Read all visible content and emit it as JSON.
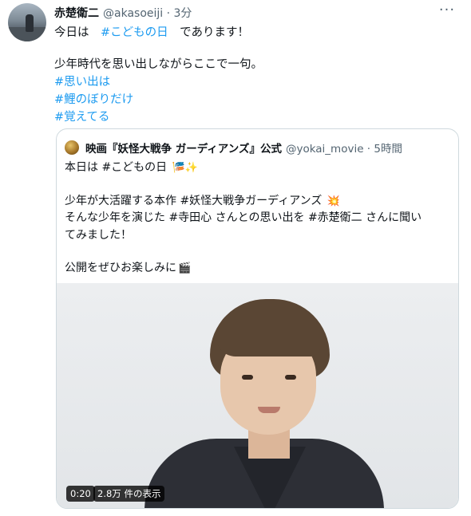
{
  "tweet": {
    "author_name": "赤楚衛二",
    "author_handle": "@akasoeiji · 3分",
    "more_icon": "more-horizontal-icon",
    "lines": [
      {
        "plain": "今日は　",
        "tag": "#こどもの日",
        "suffix": "　であります！"
      },
      {
        "plain": "少年時代を思い出しながらここで一句。"
      },
      {
        "tag": "#思い出は"
      },
      {
        "tag": "#鯉のぼりだけ"
      },
      {
        "tag": "#覚えてる"
      }
    ]
  },
  "quote": {
    "author_name": "映画『妖怪大戦争 ガーディアンズ』公式",
    "author_handle": "@yokai_movie · 5時間",
    "line1": "本日は #こどもの日",
    "line1_emoji": "🎏✨",
    "line2": "少年が大活躍する本作 #妖怪大戦争ガーディアンズ",
    "line2_emoji": "💥",
    "line3": "そんな少年を演じた #寺田心 さんとの思い出を #赤楚衛二 さんに聞い",
    "line4": "てみました！",
    "line5": "公開をぜひお楽しみに",
    "line5_emoji": "🎬",
    "video": {
      "duration": "0:20",
      "views": "2.8万 件の表示"
    }
  },
  "colors": {
    "link": "#1d9bf0",
    "muted": "#536471",
    "border": "#cfd9de"
  }
}
